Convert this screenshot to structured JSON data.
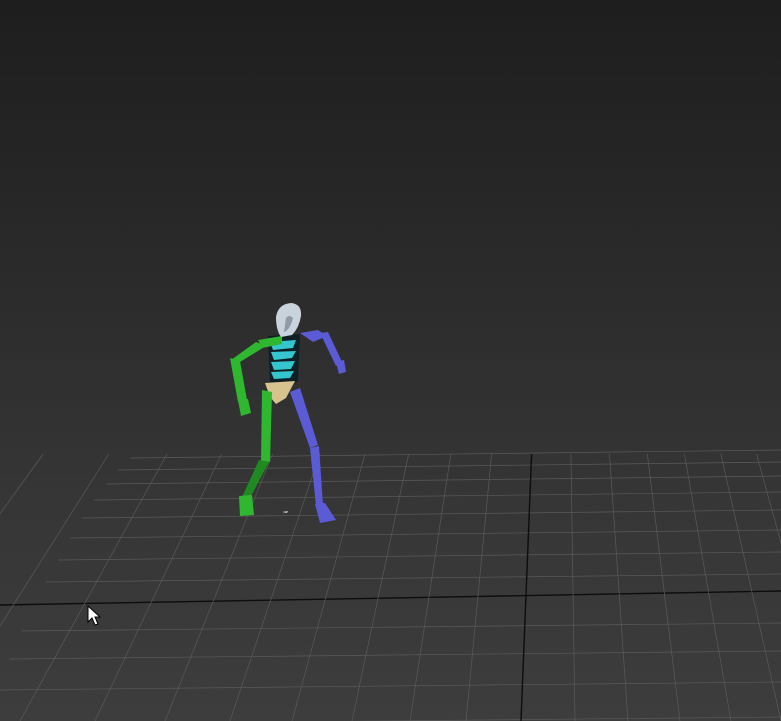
{
  "viewport": {
    "name": "3d-perspective-viewport",
    "background_top": "#1e1e1e",
    "background_bottom": "#3d3d3d"
  },
  "grid": {
    "visible": true,
    "line_color": "#5a5a5a",
    "axis_color": "#0d0d0d"
  },
  "biped": {
    "pose": "walking stride",
    "colors": {
      "head": "#c9d3dc",
      "spine": "#35c5cf",
      "spine_dark": "#0e2025",
      "pelvis": "#d6c38e",
      "left_side": "#2fb82f",
      "left_side_dark": "#1f8a1f",
      "right_side": "#5b5bd6",
      "right_side_dark": "#4040b0"
    }
  },
  "cursor": {
    "icon": "arrow-cursor-icon",
    "color": "#ffffff"
  }
}
